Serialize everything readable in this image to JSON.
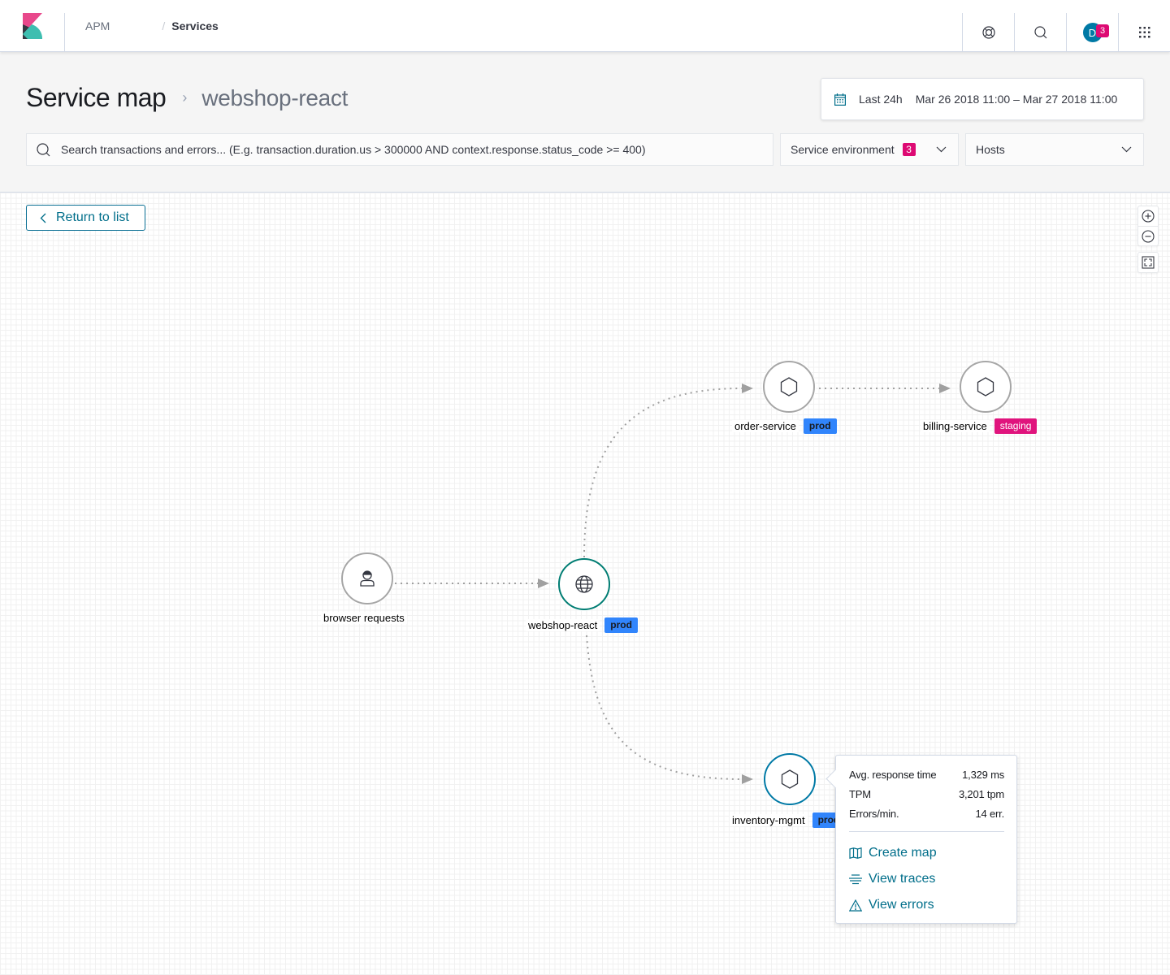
{
  "nav": {
    "breadcrumbs": [
      "APM",
      "Services"
    ],
    "breadcrumb_separator": "/",
    "avatar_initial": "D",
    "notification_count": "3",
    "icons": [
      "help-lifebuoy-icon",
      "search-icon",
      "user-avatar",
      "apps-grid-icon"
    ]
  },
  "header": {
    "title": "Service map",
    "separator": "›",
    "subtitle": "webshop-react",
    "date_picker": {
      "quick_label": "Last 24h",
      "range": "Mar 26 2018 11:00 – Mar 27 2018 11:00"
    },
    "search": {
      "value": "",
      "placeholder": "Search transactions and errors... (E.g. transaction.duration.us > 300000 AND context.response.status_code >= 400)"
    },
    "filters": [
      {
        "label": "Service environment",
        "badge": "3"
      },
      {
        "label": "Hosts",
        "badge": null
      }
    ]
  },
  "map": {
    "return_label": "Return to list",
    "controls": [
      "zoom-in",
      "zoom-out",
      "fit-to-screen"
    ],
    "colors": {
      "edge": "#a0a0a0",
      "node_border": "#a6a6a6",
      "selected_teal": "#017d73",
      "selected_blue": "#0079a5",
      "prod_badge": "#3185fc",
      "staging_badge": "#e0147d"
    },
    "nodes": [
      {
        "id": "browser",
        "name": "browser requests",
        "icon": "user-icon",
        "env": null
      },
      {
        "id": "webshop",
        "name": "webshop-react",
        "icon": "globe-icon",
        "env": "prod"
      },
      {
        "id": "order",
        "name": "order-service",
        "icon": "hexagon-icon",
        "env": "prod"
      },
      {
        "id": "billing",
        "name": "billing-service",
        "icon": "hexagon-icon",
        "env": "staging"
      },
      {
        "id": "inventory",
        "name": "inventory-mgmt",
        "icon": "hexagon-icon",
        "env": "prod"
      }
    ],
    "edges": [
      {
        "from": "browser",
        "to": "webshop"
      },
      {
        "from": "webshop",
        "to": "order"
      },
      {
        "from": "order",
        "to": "billing"
      },
      {
        "from": "webshop",
        "to": "inventory"
      }
    ],
    "popover": {
      "node": "inventory-mgmt",
      "metrics": [
        {
          "label": "Avg. response time",
          "value": "1,329 ms"
        },
        {
          "label": "TPM",
          "value": "3,201 tpm"
        },
        {
          "label": "Errors/min.",
          "value": "14 err."
        }
      ],
      "actions": [
        {
          "label": "Create map",
          "icon": "map-icon"
        },
        {
          "label": "View traces",
          "icon": "traces-icon"
        },
        {
          "label": "View errors",
          "icon": "warning-icon"
        }
      ]
    }
  }
}
